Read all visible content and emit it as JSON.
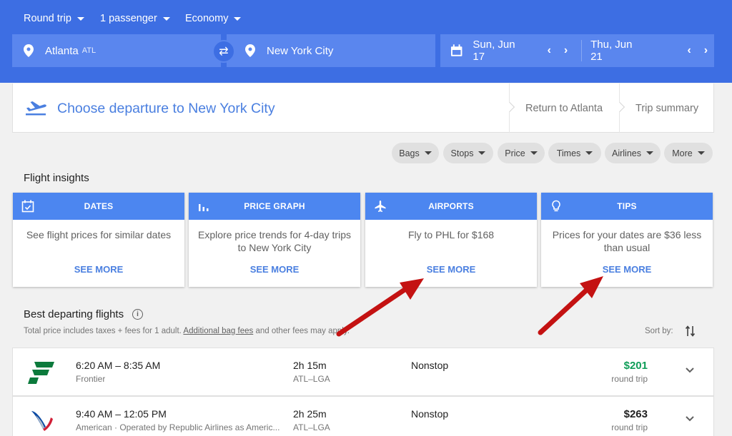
{
  "header": {
    "trip_type": "Round trip",
    "passengers": "1 passenger",
    "cabin": "Economy",
    "origin": {
      "city": "Atlanta",
      "code": "ATL"
    },
    "destination": {
      "city": "New York City"
    },
    "depart_date": "Sun, Jun 17",
    "return_date": "Thu, Jun 21"
  },
  "steps": {
    "current": "Choose departure to New York City",
    "next": "Return to Atlanta",
    "summary": "Trip summary"
  },
  "filters": [
    "Bags",
    "Stops",
    "Price",
    "Times",
    "Airlines",
    "More"
  ],
  "insights": {
    "title": "Flight insights",
    "cards": [
      {
        "icon": "calendar-icon",
        "title": "DATES",
        "text": "See flight prices for similar dates",
        "link": "SEE MORE"
      },
      {
        "icon": "bar-chart-icon",
        "title": "PRICE GRAPH",
        "text": "Explore price trends for 4-day trips to New York City",
        "link": "SEE MORE"
      },
      {
        "icon": "airplane-icon",
        "title": "AIRPORTS",
        "text": "Fly to PHL for $168",
        "link": "SEE MORE"
      },
      {
        "icon": "lightbulb-icon",
        "title": "TIPS",
        "text": "Prices for your dates are $36 less than usual",
        "link": "SEE MORE"
      }
    ]
  },
  "best": {
    "title": "Best departing flights",
    "note_prefix": "Total price includes taxes + fees for 1 adult.",
    "note_link": "Additional bag fees",
    "note_suffix": "and other fees may apply.",
    "sort_label": "Sort by:"
  },
  "flights": [
    {
      "times": "6:20 AM – 8:35 AM",
      "airline": "Frontier",
      "duration": "2h 15m",
      "route": "ATL–LGA",
      "stops": "Nonstop",
      "price": "$201",
      "price_note": "round trip",
      "price_color": "#0f9d58",
      "logo": "frontier-logo-icon"
    },
    {
      "times": "9:40 AM – 12:05 PM",
      "airline": "American · Operated by Republic Airlines as Americ...",
      "duration": "2h 25m",
      "route": "ATL–LGA",
      "stops": "Nonstop",
      "price": "$263",
      "price_note": "round trip",
      "price_color": "#212121",
      "logo": "american-logo-icon"
    }
  ],
  "colors": {
    "header_bg": "#3d6ee3",
    "field_bg": "#5a86ee",
    "card_head": "#4c86f0",
    "link": "#4a7fe0",
    "annotation": "#c41212"
  }
}
